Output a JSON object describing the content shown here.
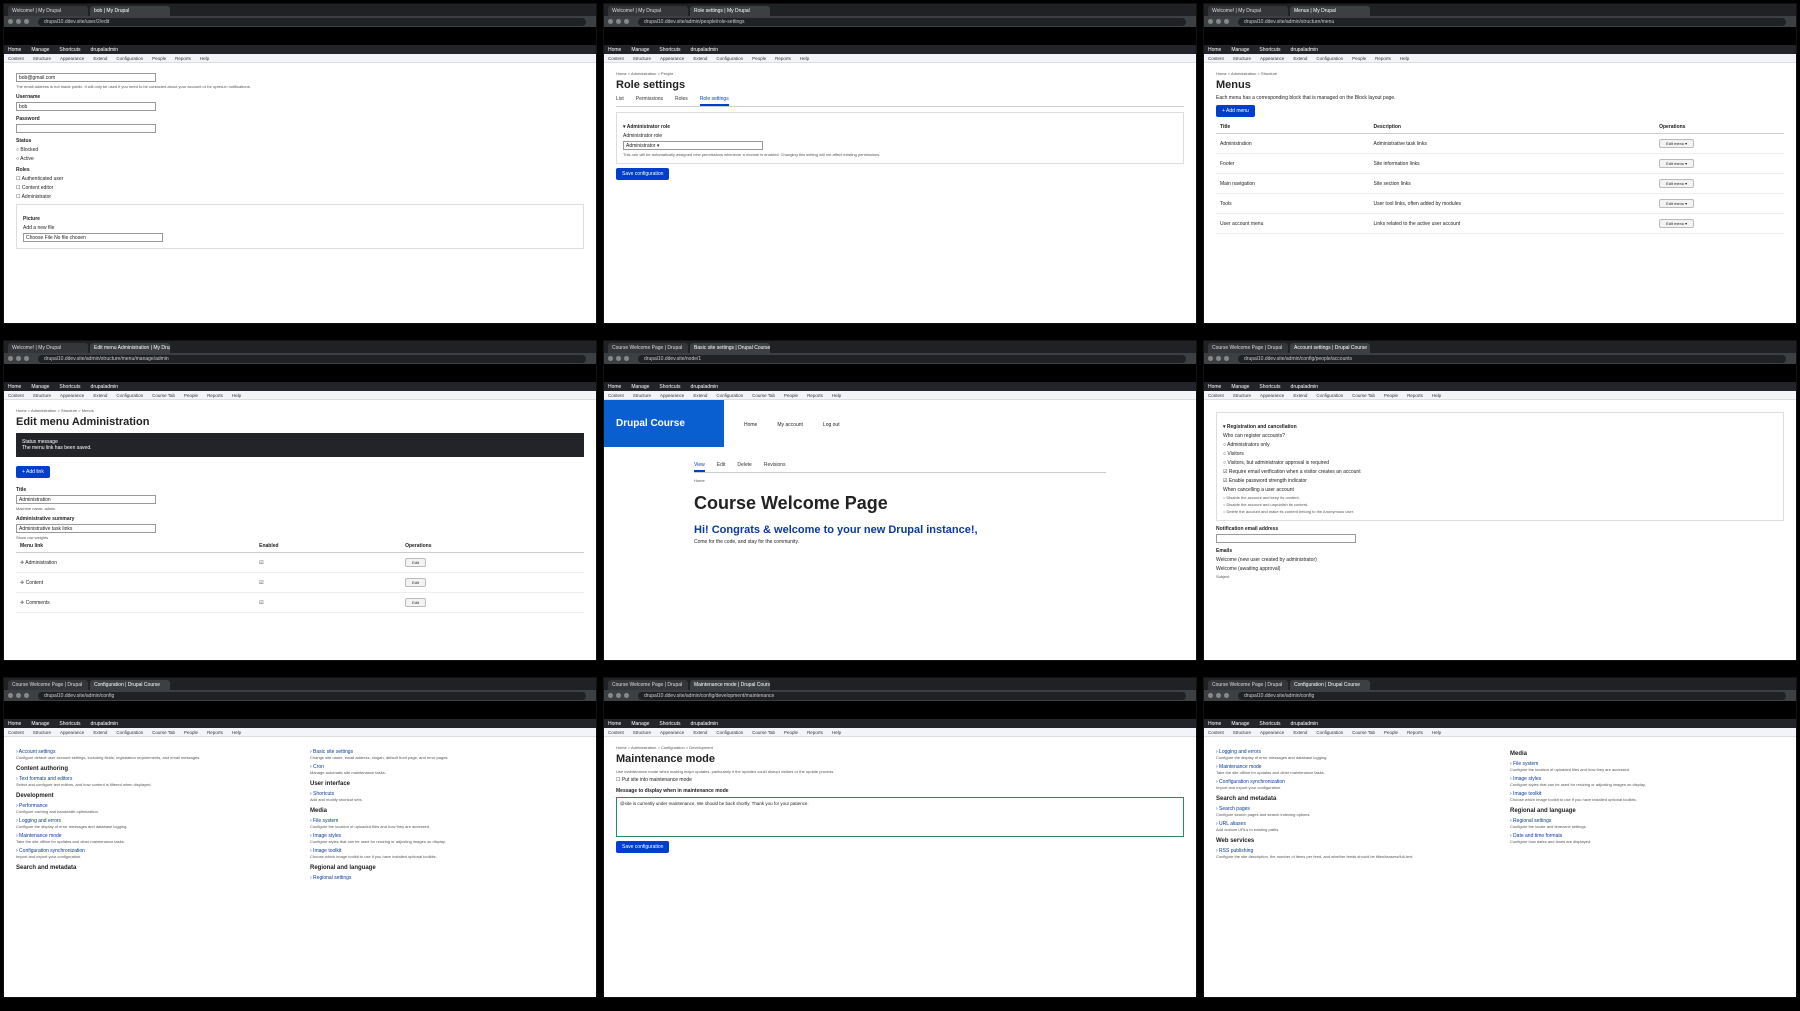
{
  "panels": [
    {
      "tabs": [
        "Welcome! | My Drupal",
        "bob | My Drupal"
      ],
      "url": "drupal10.ddev.site/user/2/edit",
      "toolbar": [
        "Home",
        "Manage",
        "Shortcuts",
        "drupaladmin"
      ],
      "admin_menu": [
        "Content",
        "Structure",
        "Appearance",
        "Extend",
        "Configuration",
        "People",
        "Reports",
        "Help"
      ],
      "email_value": "bob@gmail.com",
      "email_help": "The email address is not made public. It will only be used if you need to be contacted about your account or for opted-in notifications.",
      "username_label": "Username",
      "username_value": "bob",
      "password_label": "Password",
      "status_label": "Status",
      "status_options": [
        "Blocked",
        "Active"
      ],
      "roles_label": "Roles",
      "roles_options": [
        "Authenticated user",
        "Content editor",
        "Administrator"
      ],
      "picture_label": "Picture",
      "add_file_label": "Add a new file",
      "choose_file": "Choose File",
      "no_file": "No file chosen"
    },
    {
      "tabs": [
        "Welcome! | My Drupal",
        "Role settings | My Drupal"
      ],
      "url": "drupal10.ddev.site/admin/people/role-settings",
      "toolbar": [
        "Home",
        "Manage",
        "Shortcuts",
        "drupaladmin"
      ],
      "admin_menu": [
        "Content",
        "Structure",
        "Appearance",
        "Extend",
        "Configuration",
        "People",
        "Reports",
        "Help"
      ],
      "breadcrumb": "Home  >  Administration  >  People",
      "title": "Role settings",
      "tabs_inner": [
        "List",
        "Permissions",
        "Roles",
        "Role settings"
      ],
      "section": "Administrator role",
      "field_label": "Administrator role",
      "field_value": "Administrator",
      "help": "This role will be automatically assigned new permissions whenever a module is enabled. Changing this setting will not affect existing permissions.",
      "save": "Save configuration"
    },
    {
      "tabs": [
        "Welcome! | My Drupal",
        "Menus | My Drupal"
      ],
      "url": "drupal10.ddev.site/admin/structure/menu",
      "toolbar": [
        "Home",
        "Manage",
        "Shortcuts",
        "drupaladmin"
      ],
      "admin_menu": [
        "Content",
        "Structure",
        "Appearance",
        "Extend",
        "Configuration",
        "People",
        "Reports",
        "Help"
      ],
      "breadcrumb": "Home  >  Administration  >  Structure",
      "title": "Menus",
      "intro": "Each menu has a corresponding block that is managed on the Block layout page.",
      "add_menu": "+ Add menu",
      "headers": [
        "Title",
        "Description",
        "Operations"
      ],
      "rows": [
        [
          "Administration",
          "Administrative task links",
          "Edit menu"
        ],
        [
          "Footer",
          "Site information links",
          "Edit menu"
        ],
        [
          "Main navigation",
          "Site section links",
          "Edit menu"
        ],
        [
          "Tools",
          "User tool links, often added by modules",
          "Edit menu"
        ],
        [
          "User account menu",
          "Links related to the active user account",
          "Edit menu"
        ]
      ]
    },
    {
      "tabs": [
        "Welcome! | My Drupal",
        "Edit menu Administration | My Drupal"
      ],
      "url": "drupal10.ddev.site/admin/structure/menu/manage/admin",
      "toolbar": [
        "Home",
        "Manage",
        "Shortcuts",
        "drupaladmin"
      ],
      "admin_menu": [
        "Content",
        "Structure",
        "Appearance",
        "Extend",
        "Configuration",
        "Course Tab",
        "People",
        "Reports",
        "Help"
      ],
      "breadcrumb": "Home  >  Administration  >  Structure  >  Menus",
      "title": "Edit menu Administration",
      "status_title": "Status message",
      "status_msg": "The menu link has been saved.",
      "add_link": "+ Add link",
      "title_label": "Title",
      "title_value": "Administration",
      "machine": "Machine name: admin",
      "summary_label": "Administrative summary",
      "summary_value": "Administrative task links",
      "weights": "Show row weights",
      "headers": [
        "Menu link",
        "Enabled",
        "Operations"
      ],
      "rows": [
        [
          "Administration",
          "Edit"
        ],
        [
          "Content",
          "Edit"
        ],
        [
          "Comments",
          "Edit"
        ]
      ]
    },
    {
      "tabs": [
        "Course Welcome Page | Drupal",
        "Basic site settings | Drupal Course"
      ],
      "url": "drupal10.ddev.site/node/1",
      "toolbar": [
        "Home",
        "Manage",
        "Shortcuts",
        "drupaladmin"
      ],
      "admin_menu": [
        "Content",
        "Structure",
        "Appearance",
        "Extend",
        "Configuration",
        "Course Tab",
        "People",
        "Reports",
        "Help"
      ],
      "site_name": "Drupal Course",
      "nav": [
        "Home",
        "My account",
        "Log out"
      ],
      "local_tabs": [
        "View",
        "Edit",
        "Delete",
        "Revisions"
      ],
      "crumb": "Home",
      "title": "Course Welcome Page",
      "subtitle": "Hi! Congrats & welcome to your new Drupal instance!,",
      "body": "Come for the code, and stay for the community."
    },
    {
      "tabs": [
        "Course Welcome Page | Drupal",
        "Account settings | Drupal Course"
      ],
      "url": "drupal10.ddev.site/admin/config/people/accounts",
      "toolbar": [
        "Home",
        "Manage",
        "Shortcuts",
        "drupaladmin"
      ],
      "admin_menu": [
        "Content",
        "Structure",
        "Appearance",
        "Extend",
        "Configuration",
        "Course Tab",
        "People",
        "Reports",
        "Help"
      ],
      "section": "Registration and cancellation",
      "who_label": "Who can register accounts?",
      "who_opts": [
        "Administrators only",
        "Visitors",
        "Visitors, but administrator approval is required"
      ],
      "verify": "Require email verification when a visitor creates an account",
      "strength": "Enable password strength indicator",
      "cancel_label": "When cancelling a user account",
      "cancel_opts": [
        "Disable the account and keep its content.",
        "Disable the account and unpublish its content.",
        "Delete the account and make its content belong to the Anonymous user."
      ],
      "notify_label": "Notification email address",
      "emails_label": "Emails",
      "email_tabs": [
        "Welcome (new user created by administrator)",
        "Welcome (awaiting approval)"
      ],
      "subject": "Subject"
    },
    {
      "tabs": [
        "Course Welcome Page | Drupal",
        "Configuration | Drupal Course"
      ],
      "url": "drupal10.ddev.site/admin/config",
      "toolbar": [
        "Home",
        "Manage",
        "Shortcuts",
        "drupaladmin"
      ],
      "admin_menu": [
        "Content",
        "Structure",
        "Appearance",
        "Extend",
        "Configuration",
        "Course Tab",
        "People",
        "Reports",
        "Help"
      ],
      "left": [
        {
          "head": "",
          "links": [
            [
              "Account settings",
              "Configure default user account settings, including fields, registration requirements, and email messages."
            ]
          ]
        },
        {
          "head": "Content authoring",
          "links": [
            [
              "Text formats and editors",
              "Select and configure text editors, and how content is filtered when displayed."
            ]
          ]
        },
        {
          "head": "Development",
          "links": [
            [
              "Performance",
              "Configure caching and bandwidth optimization."
            ],
            [
              "Logging and errors",
              "Configure the display of error messages and database logging."
            ],
            [
              "Maintenance mode",
              "Take the site offline for updates and other maintenance tasks."
            ],
            [
              "Configuration synchronization",
              "Import and export your configuration."
            ]
          ]
        },
        {
          "head": "Search and metadata",
          "links": []
        }
      ],
      "right": [
        {
          "head": "",
          "links": [
            [
              "Basic site settings",
              "Change site name, email address, slogan, default front page, and error pages."
            ],
            [
              "Cron",
              "Manage automatic site maintenance tasks."
            ]
          ]
        },
        {
          "head": "User interface",
          "links": [
            [
              "Shortcuts",
              "Add and modify shortcut sets."
            ]
          ]
        },
        {
          "head": "Media",
          "links": [
            [
              "File system",
              "Configure the location of uploaded files and how they are accessed."
            ],
            [
              "Image styles",
              "Configure styles that can be used for resizing or adjusting images on display."
            ],
            [
              "Image toolkit",
              "Choose which image toolkit to use if you have installed optional toolkits."
            ]
          ]
        },
        {
          "head": "Regional and language",
          "links": [
            [
              "Regional settings",
              ""
            ]
          ]
        }
      ]
    },
    {
      "tabs": [
        "Course Welcome Page | Drupal",
        "Maintenance mode | Drupal Course"
      ],
      "url": "drupal10.ddev.site/admin/config/development/maintenance",
      "toolbar": [
        "Home",
        "Manage",
        "Shortcuts",
        "drupaladmin"
      ],
      "admin_menu": [
        "Content",
        "Structure",
        "Appearance",
        "Extend",
        "Configuration",
        "Course Tab",
        "People",
        "Reports",
        "Help"
      ],
      "breadcrumb": "Home  >  Administration  >  Configuration  >  Development",
      "title": "Maintenance mode",
      "intro": "Use maintenance mode when making major updates, particularly if the updates could disrupt visitors or the update process.",
      "checkbox": "Put site into maintenance mode",
      "msg_label": "Message to display when in maintenance mode",
      "msg_value": "@site is currently under maintenance. We should be back shortly. Thank you for your patience.",
      "save": "Save configuration"
    },
    {
      "tabs": [
        "Course Welcome Page | Drupal",
        "Configuration | Drupal Course"
      ],
      "url": "drupal10.ddev.site/admin/config",
      "toolbar": [
        "Home",
        "Manage",
        "Shortcuts",
        "drupaladmin"
      ],
      "admin_menu": [
        "Content",
        "Structure",
        "Appearance",
        "Extend",
        "Configuration",
        "Course Tab",
        "People",
        "Reports",
        "Help"
      ],
      "left": [
        {
          "head": "",
          "links": [
            [
              "Logging and errors",
              "Configure the display of error messages and database logging."
            ],
            [
              "Maintenance mode",
              "Take the site offline for updates and other maintenance tasks."
            ],
            [
              "Configuration synchronization",
              "Import and export your configuration."
            ]
          ]
        },
        {
          "head": "Search and metadata",
          "links": [
            [
              "Search pages",
              "Configure search pages and search indexing options."
            ],
            [
              "URL aliases",
              "Add custom URLs to existing paths."
            ]
          ]
        },
        {
          "head": "Web services",
          "links": [
            [
              "RSS publishing",
              "Configure the site description, the number of items per feed, and whether feeds should be titles/teasers/full-text."
            ]
          ]
        }
      ],
      "right": [
        {
          "head": "Media",
          "links": [
            [
              "File system",
              "Configure the location of uploaded files and how they are accessed."
            ],
            [
              "Image styles",
              "Configure styles that can be used for resizing or adjusting images on display."
            ],
            [
              "Image toolkit",
              "Choose which image toolkit to use if you have installed optional toolkits."
            ]
          ]
        },
        {
          "head": "Regional and language",
          "links": [
            [
              "Regional settings",
              "Configure the locale and timezone settings."
            ],
            [
              "Date and time formats",
              "Configure how dates and times are displayed."
            ]
          ]
        }
      ]
    }
  ]
}
